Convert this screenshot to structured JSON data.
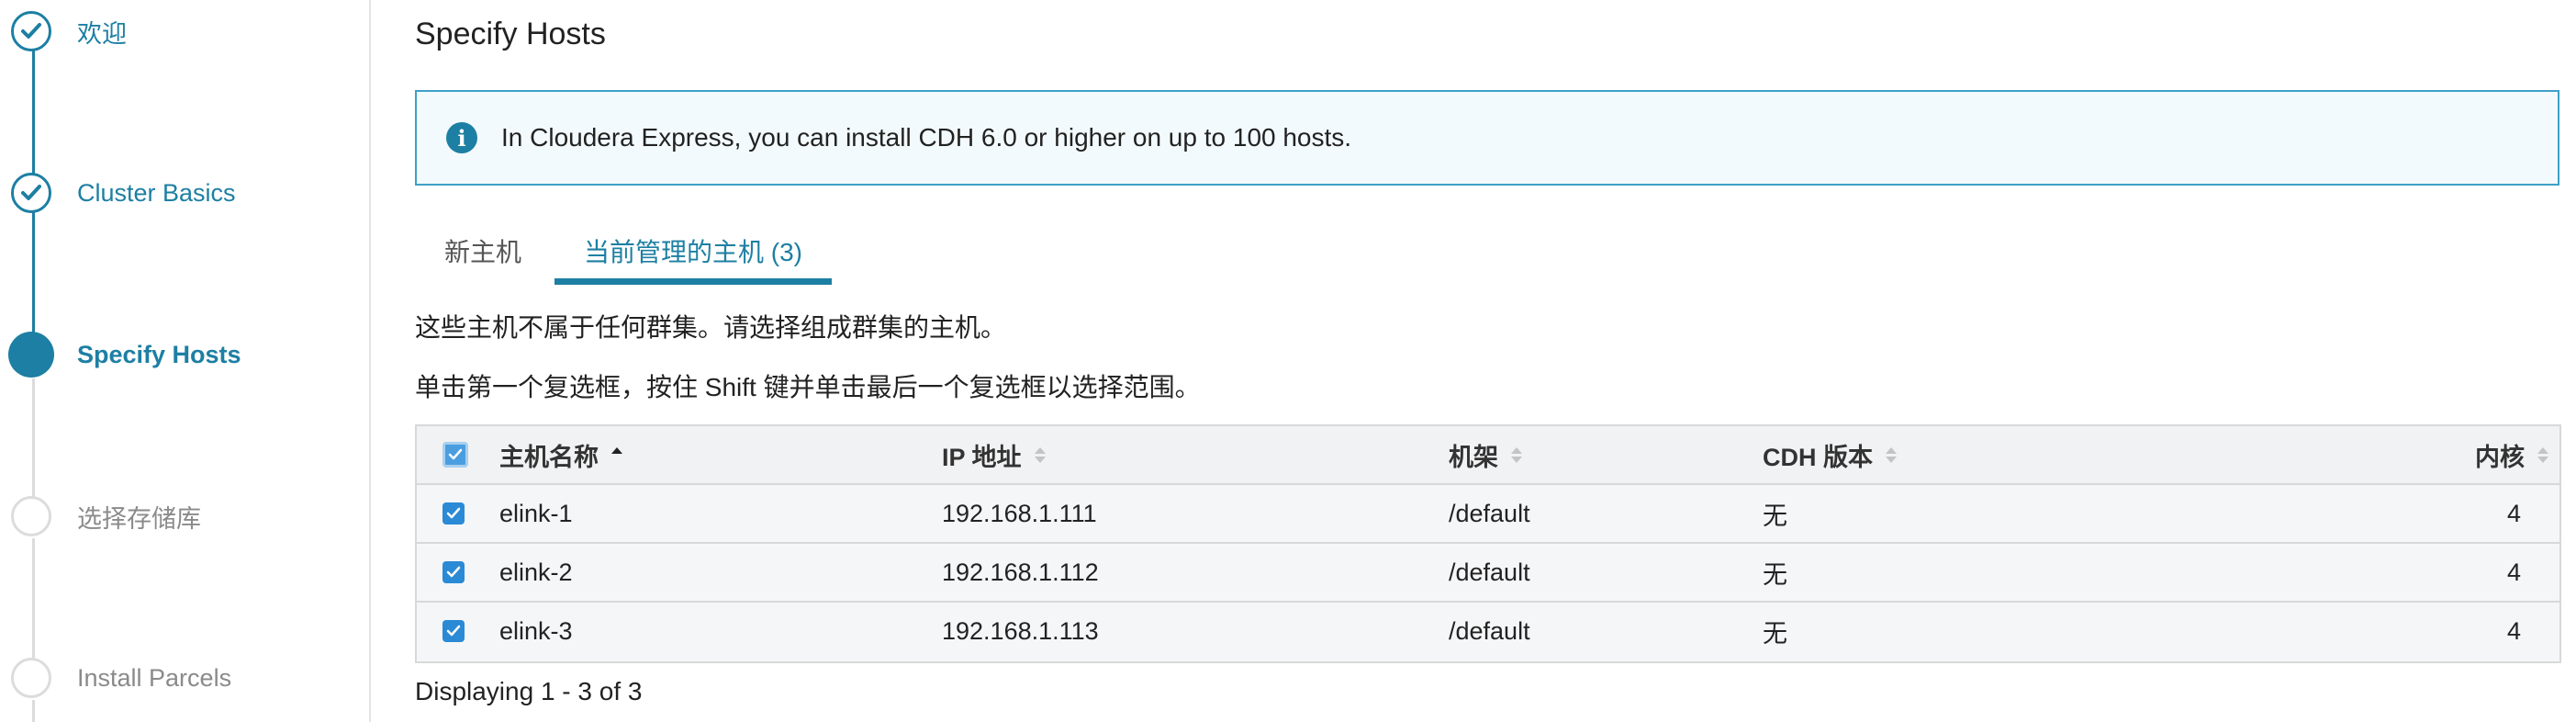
{
  "sidebar": {
    "steps": [
      {
        "label": "欢迎",
        "state": "done"
      },
      {
        "label": "Cluster Basics",
        "state": "done"
      },
      {
        "label": "Specify Hosts",
        "state": "current"
      },
      {
        "label": "选择存储库",
        "state": "todo"
      },
      {
        "label": "Install Parcels",
        "state": "todo"
      }
    ]
  },
  "main": {
    "title": "Specify Hosts",
    "info": {
      "icon": "info-icon",
      "text": "In Cloudera Express, you can install CDH 6.0 or higher on up to 100 hosts."
    },
    "tabs": [
      {
        "label": "新主机",
        "active": false
      },
      {
        "label": "当前管理的主机 (3)",
        "active": true
      }
    ],
    "description_1": "这些主机不属于任何群集。请选择组成群集的主机。",
    "description_2": "单击第一个复选框，按住 Shift 键并单击最后一个复选框以选择范围。",
    "table": {
      "columns": {
        "name": "主机名称",
        "ip": "IP 地址",
        "rack": "机架",
        "cdh": "CDH 版本",
        "cores": "内核"
      },
      "rows": [
        {
          "name": "elink-1",
          "ip": "192.168.1.111",
          "rack": "/default",
          "cdh": "无",
          "cores": "4",
          "checked": true
        },
        {
          "name": "elink-2",
          "ip": "192.168.1.112",
          "rack": "/default",
          "cdh": "无",
          "cores": "4",
          "checked": true
        },
        {
          "name": "elink-3",
          "ip": "192.168.1.113",
          "rack": "/default",
          "cdh": "无",
          "cores": "4",
          "checked": true
        }
      ]
    },
    "footer": "Displaying 1 - 3 of 3"
  },
  "colors": {
    "accent": "#1d7fa3",
    "checkbox": "#2a8ad6",
    "info_border": "#3ea0c7",
    "info_bg": "#f3fafd"
  }
}
